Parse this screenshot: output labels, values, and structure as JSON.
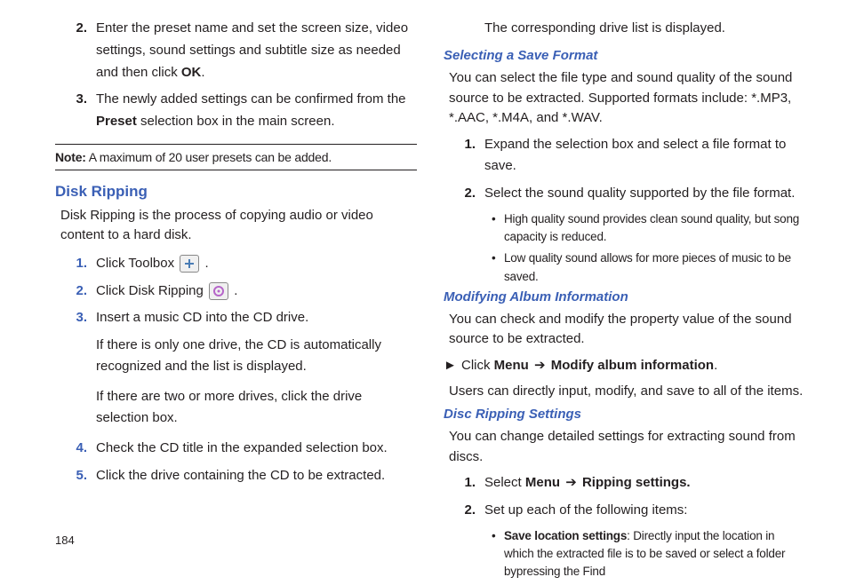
{
  "page_number": "184",
  "left": {
    "step2_pre": "Enter the preset name and set the screen size, video settings, sound settings and subtitle size as needed and then click ",
    "step2_bold": "OK",
    "step2_post": ".",
    "step3_pre": "The newly added settings can be confirmed from the ",
    "step3_bold": "Preset",
    "step3_post": " selection box in the main screen.",
    "note_label": "Note:",
    "note_text": " A maximum of 20 user presets can be added.",
    "h2": "Disk Ripping",
    "intro": "Disk Ripping is the process of copying audio or video content to a hard disk.",
    "s1": "Click Toolbox ",
    "s1_post": " .",
    "s2": "Click Disk Ripping ",
    "s2_post": " .",
    "s3": "Insert a music CD into the CD drive.",
    "s3_p1": "If there is only one drive, the CD is automatically recognized and the list is displayed.",
    "s3_p2": "If there are two or more drives, click the drive selection box.",
    "s4": "Check the CD title in the expanded selection box.",
    "s5": "Click the drive containing the CD to be extracted."
  },
  "right": {
    "top_continue": "The corresponding drive list is displayed.",
    "h3a": "Selecting a Save Format",
    "save_intro": "You can select the file type and sound quality of the sound source to be extracted. Supported formats include: *.MP3, *.AAC, *.M4A, and *.WAV.",
    "sa1": "Expand the selection box and select a file format to save.",
    "sa2": "Select the sound quality supported by the file format.",
    "bullet_hq": "High quality sound provides clean sound quality, but song capacity is reduced.",
    "bullet_lq": "Low quality sound allows for more pieces of music to be saved.",
    "h3b": "Modifying Album Information",
    "mod_intro": "You can check and modify the property value of the sound source to be extracted.",
    "mod_click_pre": "Click ",
    "mod_menu": "Menu",
    "mod_arrow": " ➔ ",
    "mod_item": "Modify album information",
    "mod_post": ".",
    "mod_users": "Users can directly input, modify, and save to all of the items.",
    "h3c": "Disc Ripping Settings",
    "drs_intro": "You can change detailed settings for extracting sound from discs.",
    "drs1_pre": "Select ",
    "drs1_menu": "Menu",
    "drs1_arrow": " ➔ ",
    "drs1_item": "Ripping settings.",
    "drs2": "Set up each of the following items:",
    "drs_b1_bold": "Save location settings",
    "drs_b1_text": ": Directly input the location in which the extracted file is to be saved or select a folder bypressing the Find"
  },
  "nums": {
    "n1": "1.",
    "n2": "2.",
    "n3": "3.",
    "n4": "4.",
    "n5": "5."
  }
}
